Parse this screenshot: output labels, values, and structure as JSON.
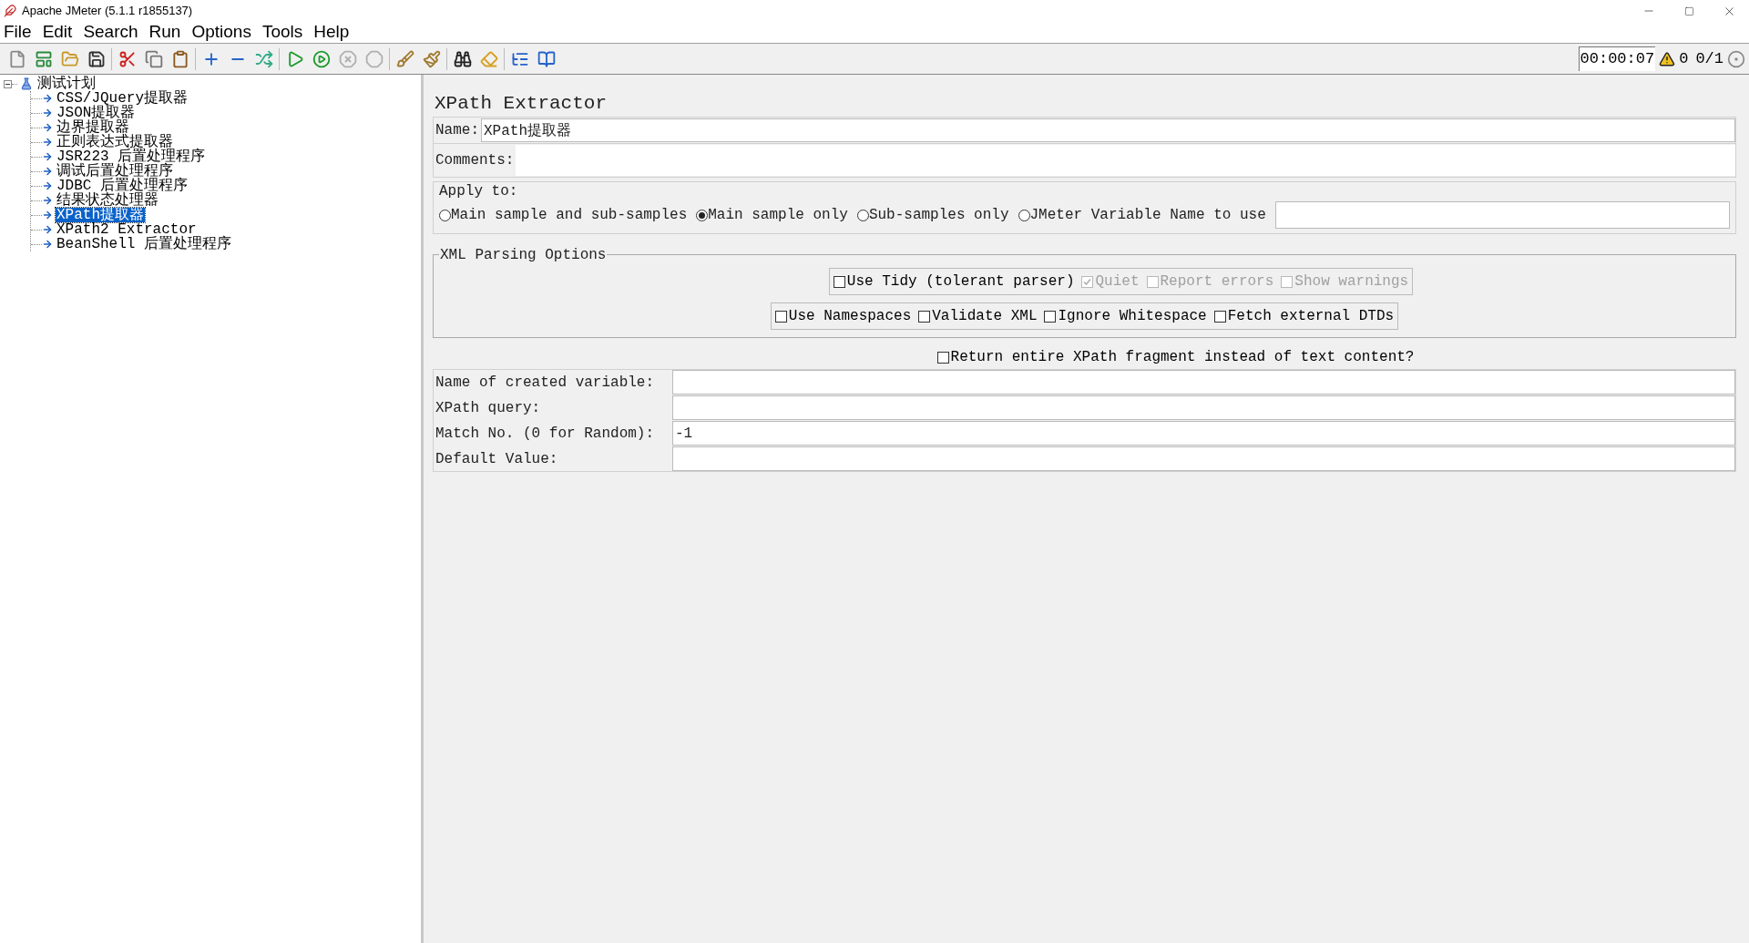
{
  "window": {
    "title": "Apache JMeter (5.1.1 r1855137)"
  },
  "menu": [
    "File",
    "Edit",
    "Search",
    "Run",
    "Options",
    "Tools",
    "Help"
  ],
  "toolbar": [
    {
      "disabled": false
    },
    {
      "disabled": false
    },
    {
      "disabled": false
    },
    {
      "disabled": false
    },
    {
      "disabled": false
    },
    {
      "disabled": false
    },
    {
      "disabled": false
    },
    {
      "disabled": false
    },
    {
      "disabled": false
    },
    {
      "disabled": false
    },
    {
      "disabled": false
    },
    {
      "disabled": false
    },
    {
      "disabled": true
    },
    {
      "disabled": true
    },
    {
      "disabled": false
    },
    {
      "disabled": false
    },
    {
      "disabled": false
    },
    {
      "disabled": false
    },
    {
      "disabled": false
    },
    {
      "disabled": false
    }
  ],
  "status": {
    "timer": "00:00:07",
    "warnings": "0",
    "threads": "0/1"
  },
  "tree": {
    "label": "测试计划",
    "expanded": true,
    "selected": false,
    "children": [
      {
        "label": "CSS/JQuery提取器",
        "selected": false
      },
      {
        "label": "JSON提取器",
        "selected": false
      },
      {
        "label": "边界提取器",
        "selected": false
      },
      {
        "label": "正则表达式提取器",
        "selected": false
      },
      {
        "label": "JSR223 后置处理程序",
        "selected": false
      },
      {
        "label": "调试后置处理程序",
        "selected": false
      },
      {
        "label": "JDBC 后置处理程序",
        "selected": false
      },
      {
        "label": "结果状态处理器",
        "selected": false
      },
      {
        "label": "XPath提取器",
        "selected": true
      },
      {
        "label": "XPath2 Extractor",
        "selected": false
      },
      {
        "label": "BeanShell 后置处理程序",
        "selected": false
      }
    ]
  },
  "panel": {
    "title": "XPath Extractor",
    "name": {
      "label": "Name:",
      "value": "XPath提取器"
    },
    "comments": {
      "label": "Comments:"
    },
    "apply_to": {
      "legend": "Apply to:",
      "options": [
        {
          "label": "Main sample and sub-samples",
          "selected": false
        },
        {
          "label": "Main sample only",
          "selected": true
        },
        {
          "label": "Sub-samples only",
          "selected": false
        },
        {
          "label": "JMeter Variable Name to use",
          "selected": false
        }
      ]
    },
    "xml_parsing": {
      "legend": "XML Parsing Options",
      "row_1": [
        {
          "label": "Use Tidy (tolerant parser)",
          "checked": false,
          "disabled": false
        },
        {
          "label": "Quiet",
          "checked": true,
          "disabled": true
        },
        {
          "label": "Report errors",
          "checked": false,
          "disabled": true
        },
        {
          "label": "Show warnings",
          "checked": false,
          "disabled": true
        }
      ],
      "row_2": [
        {
          "label": "Use Namespaces",
          "checked": false,
          "disabled": false
        },
        {
          "label": "Validate XML",
          "checked": false,
          "disabled": false
        },
        {
          "label": "Ignore Whitespace",
          "checked": false,
          "disabled": false
        },
        {
          "label": "Fetch external DTDs",
          "checked": false,
          "disabled": false
        }
      ]
    },
    "return_fragment": {
      "label": "Return entire XPath fragment instead of text content?",
      "checked": false,
      "disabled": false
    },
    "fields": [
      {
        "label": "Name of created variable:"
      },
      {
        "label": "XPath query:"
      },
      {
        "label": "Match No. (0 for Random):",
        "value": "-1"
      },
      {
        "label": "Default Value:"
      }
    ]
  }
}
